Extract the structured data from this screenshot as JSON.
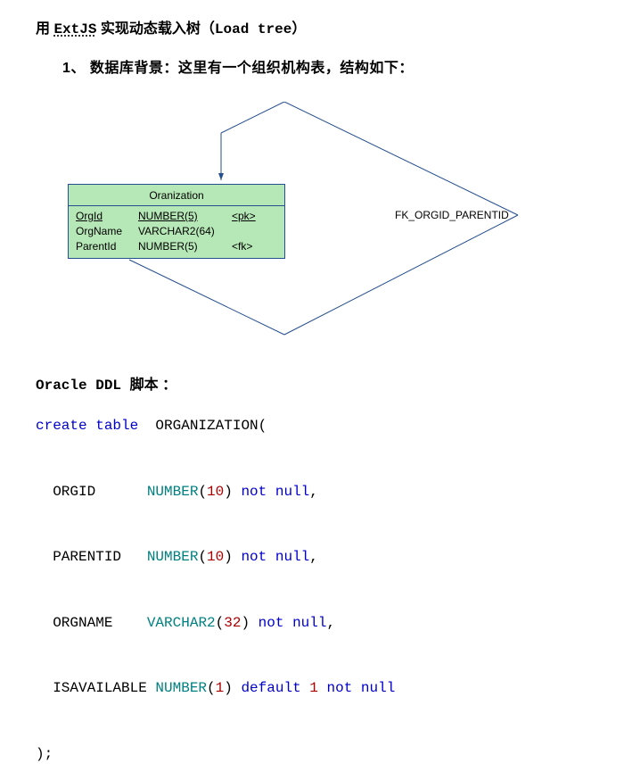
{
  "heading": {
    "prefix": "用 ",
    "extjs": "ExtJS",
    "mid": "  实现动态载入树（",
    "loadtree": "Load tree",
    "suffix": "）"
  },
  "numbered": "1、 数据库背景：这里有一个组织机构表，结构如下：",
  "diagram": {
    "entity_title": "Oranization",
    "rows": [
      {
        "col": "OrgId",
        "type": "NUMBER(5)",
        "key": "<pk>",
        "col_ul": true,
        "type_ul": true,
        "key_ul": true
      },
      {
        "col": "OrgName",
        "type": "VARCHAR2(64)",
        "key": "",
        "col_ul": false,
        "type_ul": false,
        "key_ul": false
      },
      {
        "col": "ParentId",
        "type": "NUMBER(5)",
        "key": "<fk>",
        "col_ul": false,
        "type_ul": false,
        "key_ul": false
      }
    ],
    "fk_label": "FK_ORGID_PARENTID"
  },
  "ddl_heading": {
    "oracle": "Oracle ",
    "ddl": "DDL ",
    "rest": "脚本 ："
  },
  "code": {
    "line1_a": "create table",
    "line1_b": "  ORGANIZATION(",
    "line2_a": "  ORGID      ",
    "line2_b": "NUMBER",
    "line2_c": "(",
    "line2_d": "10",
    "line2_e": ") ",
    "line2_f": "not null",
    "line2_g": ",",
    "line3_a": "  PARENTID   ",
    "line3_b": "NUMBER",
    "line3_c": "(",
    "line3_d": "10",
    "line3_e": ") ",
    "line3_f": "not null",
    "line3_g": ",",
    "line4_a": "  ORGNAME    ",
    "line4_b": "VARCHAR2",
    "line4_c": "(",
    "line4_d": "32",
    "line4_e": ") ",
    "line4_f": "not null",
    "line4_g": ",",
    "line5_a": "  ISAVAILABLE ",
    "line5_b": "NUMBER",
    "line5_c": "(",
    "line5_d": "1",
    "line5_e": ") ",
    "line5_f": "default",
    "line5_g": " ",
    "line5_h": "1",
    "line5_i": " ",
    "line5_j": "not null",
    "line6": ");"
  }
}
